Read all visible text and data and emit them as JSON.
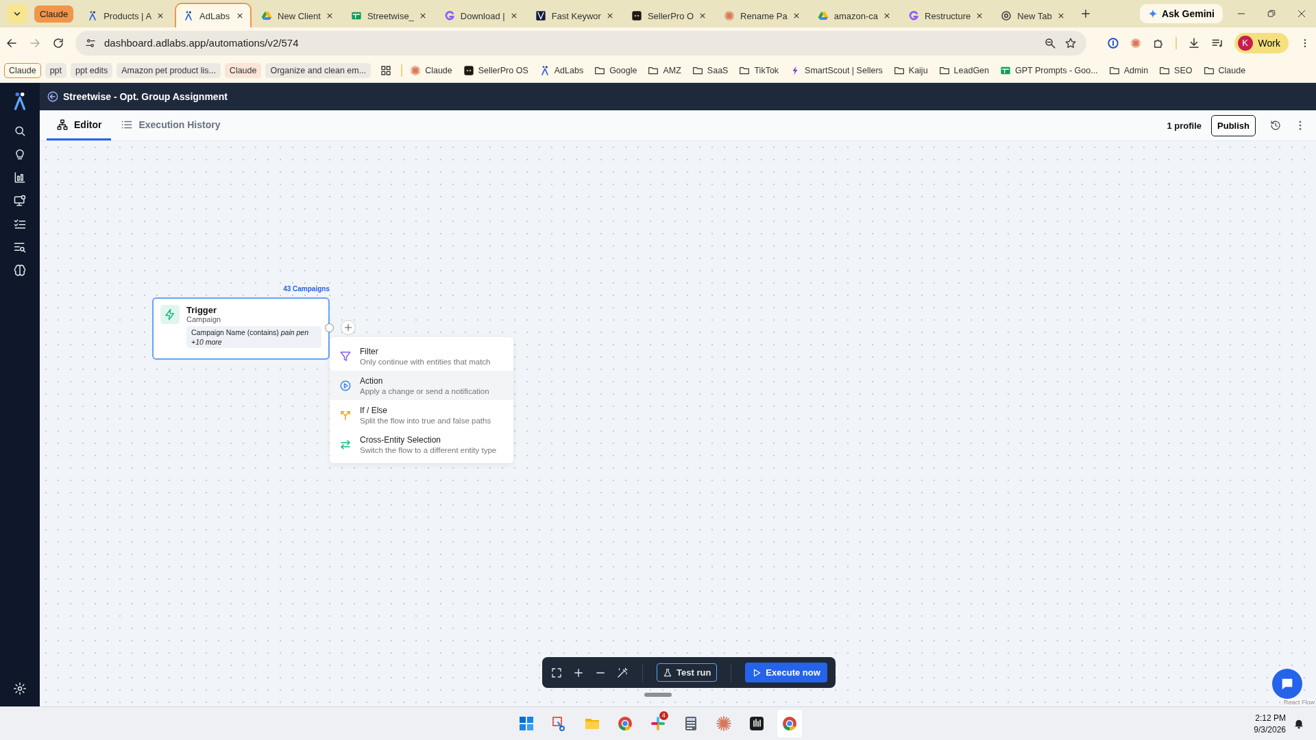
{
  "browser": {
    "group_label": "Claude",
    "tabs": [
      {
        "title": "Products | A",
        "kind": "adlabs",
        "selected": false
      },
      {
        "title": "AdLabs",
        "kind": "adlabs",
        "selected": true
      },
      {
        "title": "New Client",
        "kind": "drive",
        "selected": false
      },
      {
        "title": "Streetwise_",
        "kind": "sheets",
        "selected": false
      },
      {
        "title": "Download |",
        "kind": "letter",
        "selected": false
      },
      {
        "title": "Fast Keywor",
        "kind": "keyword",
        "selected": false
      },
      {
        "title": "SellerPro O",
        "kind": "sellerpro",
        "selected": false
      },
      {
        "title": "Rename Pa",
        "kind": "sparkle",
        "selected": false
      },
      {
        "title": "amazon-ca",
        "kind": "drive",
        "selected": false
      },
      {
        "title": "Restructure",
        "kind": "letter",
        "selected": false
      },
      {
        "title": "New Tab",
        "kind": "globe",
        "selected": false
      }
    ],
    "ask_button": "Ask Gemini",
    "url": "dashboard.adlabs.app/automations/v2/574",
    "profile": {
      "initial": "K",
      "label": "Work"
    },
    "bookmark_chips": [
      {
        "label": "Claude",
        "kind": "outlined"
      },
      {
        "label": "ppt",
        "kind": "plain"
      },
      {
        "label": "ppt edits",
        "kind": "plain"
      },
      {
        "label": "Amazon pet product lis...",
        "kind": "plain"
      },
      {
        "label": "Claude",
        "kind": "tinted"
      },
      {
        "label": "Organize and clean em...",
        "kind": "plain"
      }
    ],
    "bookmarks": [
      {
        "label": "Claude",
        "kind": "sparkle"
      },
      {
        "label": "SellerPro OS",
        "kind": "sellerpro"
      },
      {
        "label": "AdLabs",
        "kind": "adlabs"
      },
      {
        "label": "Google",
        "kind": "folder"
      },
      {
        "label": "AMZ",
        "kind": "folder"
      },
      {
        "label": "SaaS",
        "kind": "folder"
      },
      {
        "label": "TikTok",
        "kind": "folder"
      },
      {
        "label": "SmartScout | Sellers",
        "kind": "smartscout"
      },
      {
        "label": "Kaiju",
        "kind": "folder"
      },
      {
        "label": "LeadGen",
        "kind": "folder"
      },
      {
        "label": "GPT Prompts - Goo...",
        "kind": "sheets"
      },
      {
        "label": "Admin",
        "kind": "folder"
      },
      {
        "label": "SEO",
        "kind": "folder"
      },
      {
        "label": "Claude",
        "kind": "folder"
      }
    ]
  },
  "app": {
    "title": "Streetwise - Opt. Group Assignment",
    "tabs": [
      {
        "label": "Editor",
        "kind": "editor",
        "selected": true
      },
      {
        "label": "Execution History",
        "kind": "history",
        "selected": false
      }
    ],
    "profile_count": "1 profile",
    "publish_button": "Publish",
    "trigger": {
      "count": "43 Campaigns",
      "title": "Trigger",
      "subtitle": "Campaign",
      "condition": "Campaign Name (contains) *pain pen*",
      "more": "+10 more"
    },
    "step_menu": [
      {
        "kind": "filter",
        "title": "Filter",
        "description": "Only continue with entities that match",
        "selected": false
      },
      {
        "kind": "action",
        "title": "Action",
        "description": "Apply a change or send a notification",
        "selected": true
      },
      {
        "kind": "branch",
        "title": "If / Else",
        "description": "Split the flow into true and false paths",
        "selected": false
      },
      {
        "kind": "switch",
        "title": "Cross-Entity Selection",
        "description": "Switch the flow to a different entity type",
        "selected": false
      }
    ],
    "toolbar": {
      "test_button": "Test run",
      "execute_button": "Execute now"
    },
    "attribution": "React Flow"
  },
  "taskbar": {
    "badge": "4",
    "time": "2:12 PM",
    "date": "9/3/2026"
  }
}
